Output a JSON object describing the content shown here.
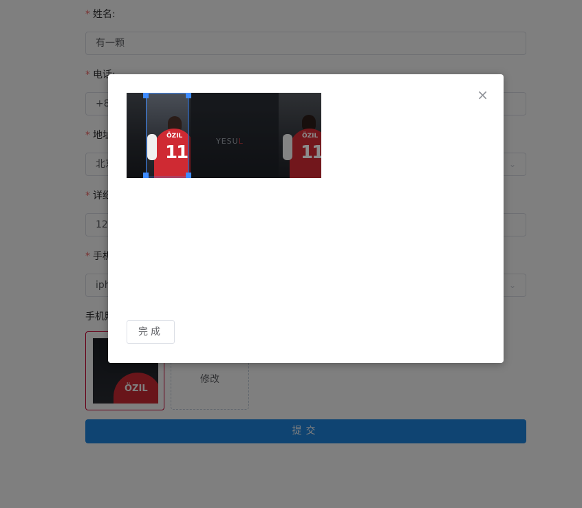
{
  "form": {
    "name": {
      "label": "姓名:",
      "value": "有一颗"
    },
    "phone": {
      "label": "电话:",
      "value": "+8"
    },
    "address": {
      "label": "地址",
      "value": "北京"
    },
    "detail": {
      "label": "详细",
      "value": "12"
    },
    "model": {
      "label": "手机",
      "value": "iph"
    },
    "photo_label": "手机照",
    "required_mark": "*",
    "upload": {
      "icon": "+",
      "label": "修改"
    },
    "submit": "提交"
  },
  "dialog": {
    "close": "×",
    "done": "完成",
    "image": {
      "brand_text": "YESU",
      "brand_accent": "L",
      "jersey_number": "11",
      "jersey_name": "ÖZIL"
    }
  },
  "colors": {
    "accent": "#1e88e5",
    "crop": "#3f8cff",
    "required": "#f56c6c"
  }
}
